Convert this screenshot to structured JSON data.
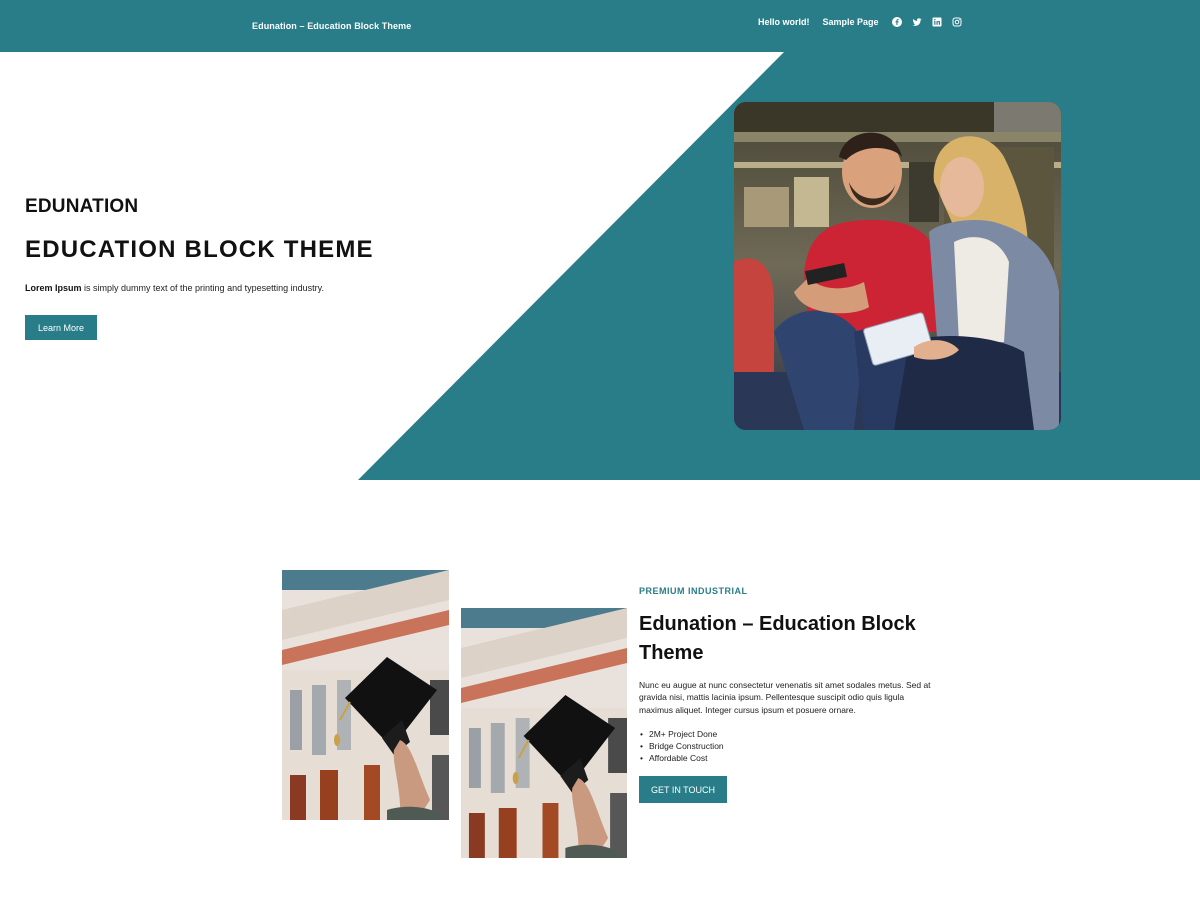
{
  "colors": {
    "accent": "#287d89",
    "text": "#111111",
    "background": "#ffffff"
  },
  "header": {
    "site_title": "Edunation – Education Block Theme",
    "nav": [
      {
        "label": "Hello world!"
      },
      {
        "label": "Sample Page"
      }
    ],
    "social_icons": [
      "facebook-icon",
      "twitter-icon",
      "linkedin-icon",
      "instagram-icon"
    ]
  },
  "hero": {
    "kicker": "EDUNATION",
    "title": "EDUCATION BLOCK THEME",
    "desc_bold": "Lorem Ipsum",
    "desc_rest": " is simply dummy text of the printing and typesetting industry.",
    "button": "Learn More",
    "photo": "students-sitting-photo"
  },
  "about": {
    "kicker": "PREMIUM INDUSTRIAL",
    "title": "Edunation – Education Block Theme",
    "description": "Nunc eu augue at nunc consectetur venenatis sit amet sodales metus. Sed at gravida nisi, mattis lacinia ipsum. Pellentesque suscipit odio quis ligula maximus aliquet. Integer cursus ipsum et posuere ornare.",
    "list": [
      "2M+ Project Done",
      "Bridge Construction",
      "Affordable Cost"
    ],
    "button": "GET IN TOUCH",
    "photos": [
      "graduation-cap-photo",
      "graduation-cap-photo"
    ]
  }
}
